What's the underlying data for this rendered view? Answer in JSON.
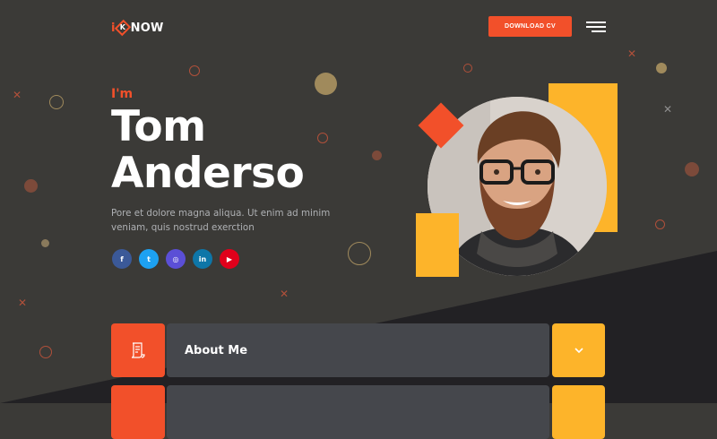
{
  "header": {
    "logo_prefix": "i",
    "logo_k": "K",
    "logo_suffix": "NOW",
    "download_label": "DOWNLOAD CV",
    "menu_icon": "hamburger-icon"
  },
  "hero": {
    "intro": "I'm",
    "name_line1": "Tom",
    "name_line2": "Anderso",
    "bio": "Pore et dolore magna aliqua. Ut enim ad minim veniam, quis nostrud exerction",
    "socials": [
      {
        "name": "facebook",
        "glyph": "f",
        "color": "#3b5998"
      },
      {
        "name": "twitter",
        "glyph": "t",
        "color": "#1da1f2"
      },
      {
        "name": "instagram",
        "glyph": "◎",
        "color": "#5b4fd6"
      },
      {
        "name": "linkedin",
        "glyph": "in",
        "color": "#0e76a8"
      },
      {
        "name": "youtube",
        "glyph": "▶",
        "color": "#e0001b"
      }
    ]
  },
  "accordion": [
    {
      "title": "About Me",
      "icon": "document-icon"
    },
    {
      "title": "",
      "icon": "document-icon"
    }
  ],
  "colors": {
    "background": "#3b3a37",
    "background_dark": "#222124",
    "accent_orange": "#f2502a",
    "accent_yellow": "#fdb42a",
    "panel": "#45474c"
  }
}
